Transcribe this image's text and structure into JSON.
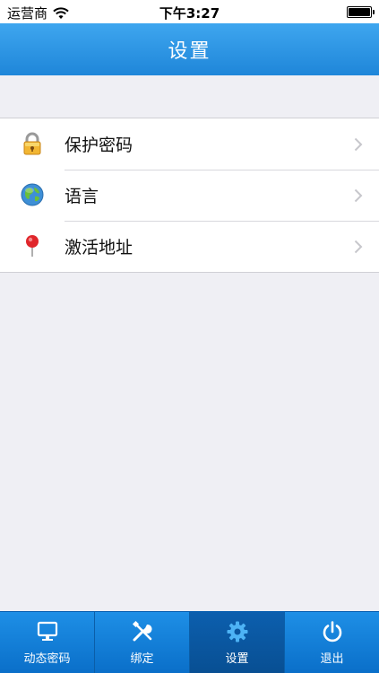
{
  "status_bar": {
    "carrier": "运营商",
    "time": "下午3:27"
  },
  "nav": {
    "title": "设置"
  },
  "settings": {
    "items": [
      {
        "label": "保护密码",
        "icon": "lock-icon"
      },
      {
        "label": "语言",
        "icon": "globe-icon"
      },
      {
        "label": "激活地址",
        "icon": "map-pin-icon"
      }
    ]
  },
  "tabs": [
    {
      "label": "动态密码",
      "icon": "monitor-icon"
    },
    {
      "label": "绑定",
      "icon": "tools-icon"
    },
    {
      "label": "设置",
      "icon": "gear-icon",
      "active": true
    },
    {
      "label": "退出",
      "icon": "power-icon"
    }
  ],
  "colors": {
    "nav_bg": "#2a94e3",
    "tab_bg": "#1179d2",
    "tab_active_bg": "#0a56a0",
    "page_bg": "#efeff4"
  }
}
